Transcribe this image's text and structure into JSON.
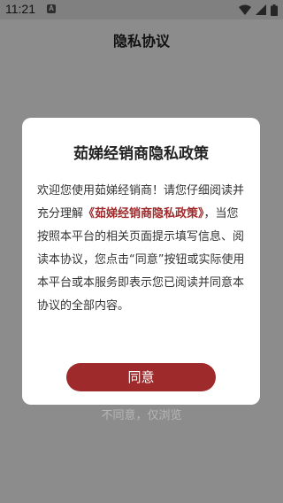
{
  "status_bar": {
    "time": "11:21",
    "notification_letter": "A",
    "icons": [
      "wifi-icon",
      "signal-icon",
      "battery-icon"
    ]
  },
  "header": {
    "title": "隐私协议"
  },
  "dialog": {
    "title": "茹娣经销商隐私政策",
    "body_pre": "欢迎您使用茹娣经销商！请您仔细阅读并充分理解",
    "policy_link": "《茹娣经销商隐私政策》",
    "body_post": "，当您按照本平台的相关页面提示填写信息、阅读本协议，您点击“同意”按钮或实际使用本平台或本服务即表示您已阅读并同意本协议的全部内容。",
    "agree_label": "同意"
  },
  "disagree_label": "不同意，仅浏览",
  "colors": {
    "accent": "#9e2a2b",
    "overlay": "rgba(0,0,0,0.45)",
    "status_bar": "#e9e9e9"
  }
}
